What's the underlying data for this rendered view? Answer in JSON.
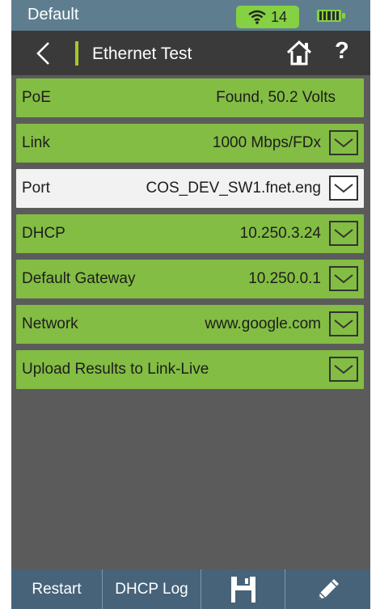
{
  "status": {
    "profile": "Default",
    "wifi_signal": "14",
    "battery_icon": "battery-full-icon"
  },
  "header": {
    "title": "Ethernet Test"
  },
  "rows": [
    {
      "label": "PoE",
      "value": "Found, 50.2 Volts"
    },
    {
      "label": "Link",
      "value": "1000 Mbps/FDx"
    },
    {
      "label": "Port",
      "value": "COS_DEV_SW1.fnet.eng"
    },
    {
      "label": "DHCP",
      "value": "10.250.3.24"
    },
    {
      "label": "Default Gateway",
      "value": "10.250.0.1"
    },
    {
      "label": "Network",
      "value": "www.google.com"
    },
    {
      "label": "Upload Results to Link-Live",
      "value": ""
    }
  ],
  "toolbar": {
    "restart": "Restart",
    "dhcp_log": "DHCP Log"
  },
  "colors": {
    "status_bar": "#5e7e90",
    "header": "#3a3a3a",
    "row_green": "#83bd43",
    "row_selected": "#f2f2f2",
    "background": "#5b5b5b",
    "toolbar": "#46637a",
    "wifi_badge": "#85d043"
  }
}
